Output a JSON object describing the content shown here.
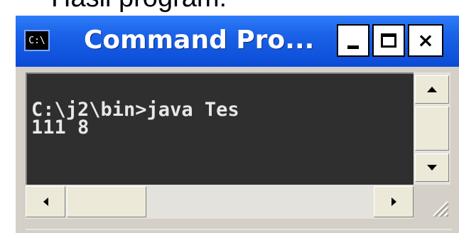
{
  "caption": "Hasil program:",
  "window": {
    "title": "Command Pro...",
    "icon": {
      "name": "cmd-icon",
      "glyph": "C:\\"
    },
    "buttons": {
      "minimize": "minimize-icon",
      "maximize": "maximize-icon",
      "close_label": "×"
    }
  },
  "console": {
    "lines": [
      "C:\\j2\\bin>java Tes",
      "111 8"
    ]
  },
  "colors": {
    "titlebar": "#0a4bd6",
    "console_bg": "#2f2f2f",
    "console_text": "#e8e8e8"
  }
}
